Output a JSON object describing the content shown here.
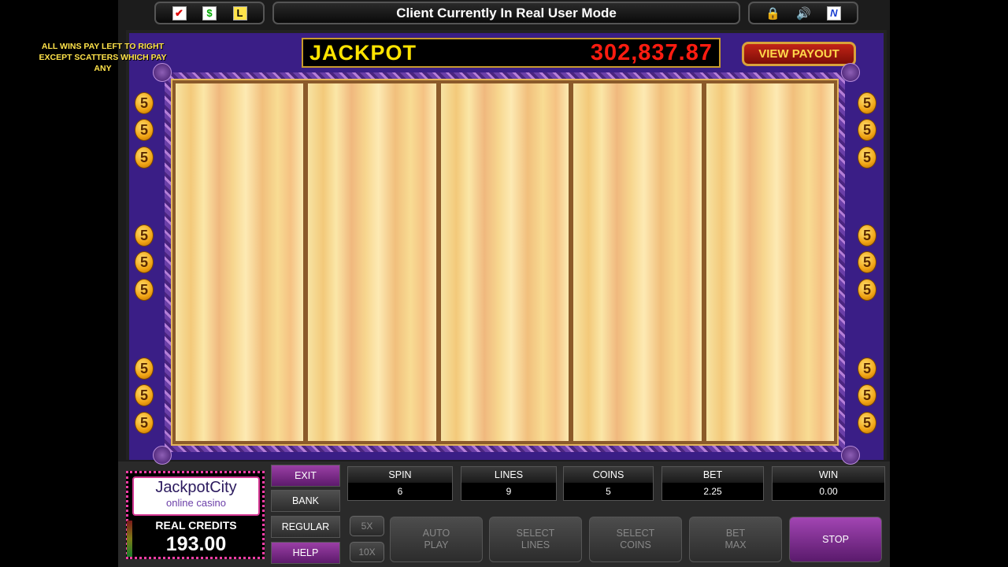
{
  "top_bar": {
    "left_icons": [
      "checkmark-icon",
      "dollar-icon",
      "l-icon"
    ],
    "left_glyphs": [
      "✔",
      "$",
      "L"
    ],
    "status_text": "Client Currently In Real User Mode",
    "right_icons": [
      "lock-icon",
      "speaker-icon",
      "n-icon"
    ],
    "right_glyphs": [
      "🔒",
      "🔊",
      "N"
    ]
  },
  "game": {
    "rules_text": "ALL WINS PAY LEFT TO RIGHT EXCEPT SCATTERS WHICH PAY ANY",
    "jackpot_label": "JACKPOT",
    "jackpot_value": "302,837.87",
    "view_payout_label": "VIEW PAYOUT",
    "line_markers_left": [
      "5",
      "5",
      "5",
      "5",
      "5",
      "5",
      "5",
      "5",
      "5"
    ],
    "line_markers_right": [
      "5",
      "5",
      "5",
      "5",
      "5",
      "5",
      "5",
      "5",
      "5"
    ],
    "reel_count": 5
  },
  "panel": {
    "brand_name": "JackpotCity",
    "brand_sub": "online casino",
    "credits_label": "REAL CREDITS",
    "credits_value": "193.00",
    "side_buttons": [
      "EXIT",
      "BANK",
      "REGULAR",
      "HELP"
    ],
    "stats": [
      {
        "label": "SPIN",
        "value": "6"
      },
      {
        "label": "LINES",
        "value": "9"
      },
      {
        "label": "COINS",
        "value": "5"
      },
      {
        "label": "BET",
        "value": "2.25"
      },
      {
        "label": "WIN",
        "value": "0.00"
      }
    ],
    "multipliers": [
      "5X",
      "10X"
    ],
    "action_buttons": [
      {
        "line1": "AUTO",
        "line2": "PLAY"
      },
      {
        "line1": "SELECT",
        "line2": "LINES"
      },
      {
        "line1": "SELECT",
        "line2": "COINS"
      },
      {
        "line1": "BET",
        "line2": "MAX"
      },
      {
        "line1": "STOP",
        "line2": ""
      }
    ]
  },
  "colors": {
    "frame_purple": "#3a1e86",
    "jackpot_yellow": "#ffe400",
    "jackpot_red": "#ff1c10",
    "button_purple": "#9a3fa5"
  }
}
